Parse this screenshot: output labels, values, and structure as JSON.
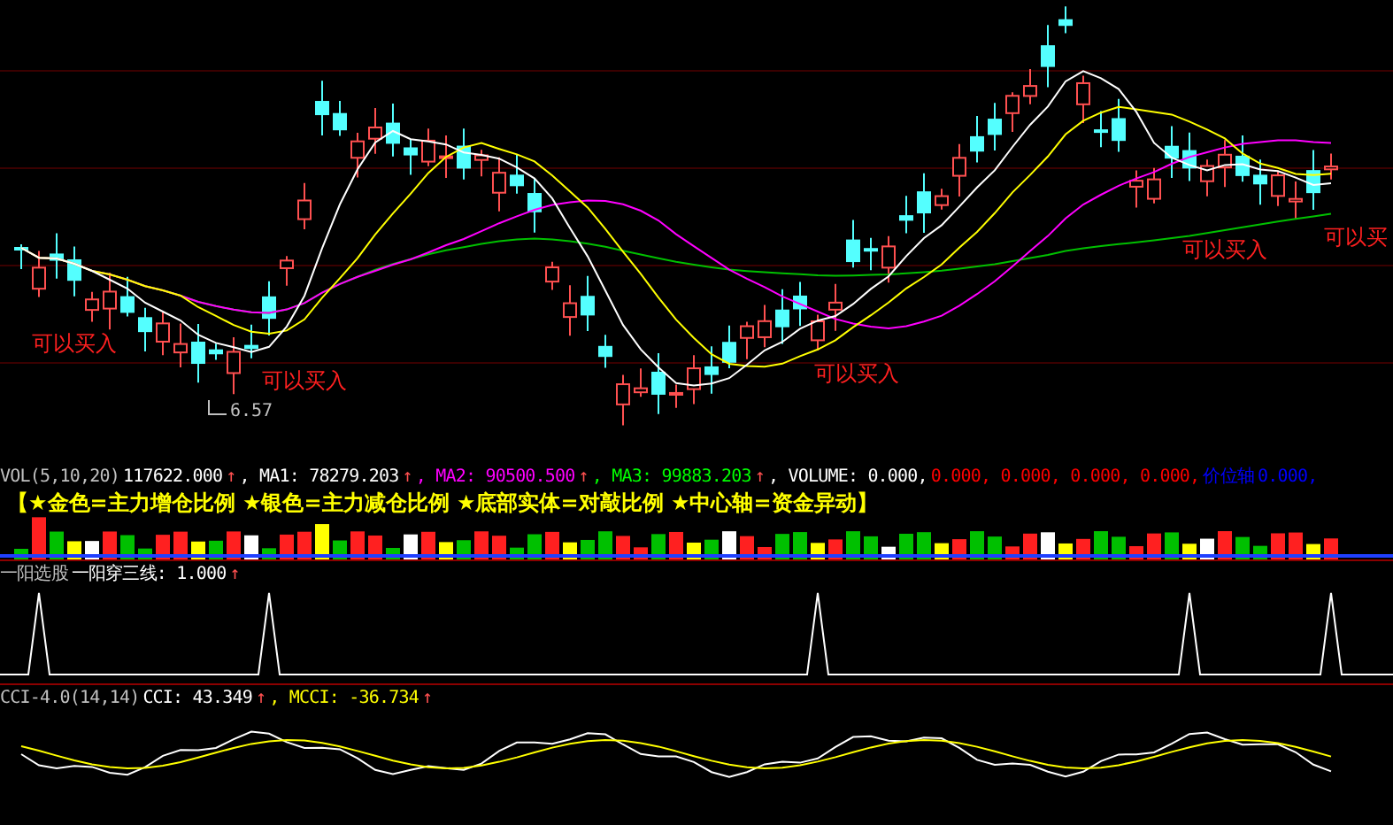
{
  "price_chart": {
    "low_marker": "6.57",
    "signals": [
      {
        "text": "可以买入"
      },
      {
        "text": "可以买入"
      },
      {
        "text": "可以买入"
      },
      {
        "text": "可以买入"
      },
      {
        "text": "可以买"
      }
    ]
  },
  "volume_legend": [
    {
      "text": "VOL(5,10,20)",
      "color": "#c0c0c0"
    },
    {
      "text": "117622.000",
      "color": "#ffffff",
      "trend": "↑"
    },
    {
      "text": ", MA1: 78279.203",
      "color": "#ffffff",
      "trend": "↑"
    },
    {
      "text": ", MA2: 90500.500",
      "color": "#ff00ff",
      "trend": "↑"
    },
    {
      "text": ", MA3: 99883.203",
      "color": "#00ff00",
      "trend": "↑"
    },
    {
      "text": ", VOLUME: 0.000,",
      "color": "#ffffff"
    },
    {
      "text": "0.000, 0.000, 0.000, 0.000,",
      "color": "#ff0000"
    },
    {
      "text": "价位轴",
      "color": "#0000ff"
    },
    {
      "text": "0.000,",
      "color": "#0000ff"
    }
  ],
  "volume_note": "【★金色=主力增仓比例 ★银色=主力减仓比例 ★底部实体=对敲比例 ★中心轴=资金异动】",
  "signal_legend": [
    {
      "text": "一阳选股",
      "color": "#c0c0c0"
    },
    {
      "text": "一阳穿三线: 1.000",
      "color": "#ffffff",
      "trend": "↑"
    }
  ],
  "cci_legend": [
    {
      "text": "CCI-4.0(14,14)",
      "color": "#c0c0c0"
    },
    {
      "text": "CCI: 43.349",
      "color": "#ffffff",
      "trend": "↑"
    },
    {
      "text": ", MCCI: -36.734",
      "color": "#ffff00",
      "trend": "↑"
    }
  ]
}
